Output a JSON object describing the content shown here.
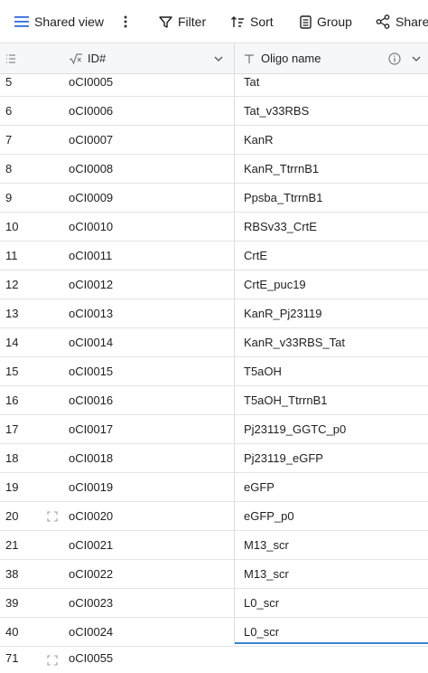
{
  "toolbar": {
    "view_label": "Shared view",
    "filter_label": "Filter",
    "sort_label": "Sort",
    "group_label": "Group",
    "share_label": "Share"
  },
  "header": {
    "col_id": "ID#",
    "col_name": "Oligo name"
  },
  "rows": [
    {
      "num": "5",
      "id": "oCI0005",
      "name": "Tat"
    },
    {
      "num": "6",
      "id": "oCI0006",
      "name": "Tat_v33RBS"
    },
    {
      "num": "7",
      "id": "oCI0007",
      "name": "KanR"
    },
    {
      "num": "8",
      "id": "oCI0008",
      "name": "KanR_TtrrnB1"
    },
    {
      "num": "9",
      "id": "oCI0009",
      "name": "Ppsba_TtrrnB1"
    },
    {
      "num": "10",
      "id": "oCI0010",
      "name": "RBSv33_CrtE"
    },
    {
      "num": "11",
      "id": "oCI0011",
      "name": "CrtE"
    },
    {
      "num": "12",
      "id": "oCI0012",
      "name": "CrtE_puc19"
    },
    {
      "num": "13",
      "id": "oCI0013",
      "name": "KanR_Pj23119"
    },
    {
      "num": "14",
      "id": "oCI0014",
      "name": "KanR_v33RBS_Tat"
    },
    {
      "num": "15",
      "id": "oCI0015",
      "name": "T5aOH"
    },
    {
      "num": "16",
      "id": "oCI0016",
      "name": "T5aOH_TtrrnB1"
    },
    {
      "num": "17",
      "id": "oCI0017",
      "name": "Pj23119_GGTC_p0"
    },
    {
      "num": "18",
      "id": "oCI0018",
      "name": "Pj23119_eGFP"
    },
    {
      "num": "19",
      "id": "oCI0019",
      "name": "eGFP"
    },
    {
      "num": "20",
      "id": "oCI0020",
      "name": "eGFP_p0"
    },
    {
      "num": "21",
      "id": "oCI0021",
      "name": "M13_scr"
    },
    {
      "num": "38",
      "id": "oCI0022",
      "name": "M13_scr"
    },
    {
      "num": "39",
      "id": "oCI0023",
      "name": "L0_scr"
    },
    {
      "num": "40",
      "id": "oCI0024",
      "name": "L0_scr"
    }
  ],
  "last_row": {
    "num": "71",
    "id": "oCI0055",
    "name": ""
  },
  "colors": {
    "accent": "#3b82d6",
    "border": "#e3e3e3",
    "header_bg": "#f6f7f8"
  }
}
